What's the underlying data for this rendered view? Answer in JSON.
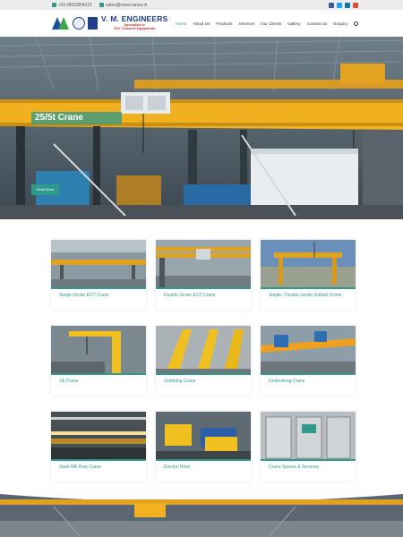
{
  "topbar": {
    "phone": "+91-8551894221",
    "email": "sales@vmecranes.in",
    "socials": [
      "facebook-icon",
      "twitter-icon",
      "linkedin-icon",
      "google-plus-icon"
    ]
  },
  "header": {
    "brand_name": "V. M. ENGINEERS",
    "brand_tagline_1": "Specialists in",
    "brand_tagline_2": "EOT Cranes & Equipments",
    "logo_text": "V M ENGINEERS",
    "nav": [
      "Home",
      "About Us",
      "Products",
      "Services",
      "Our Clients",
      "Gallery",
      "Contact Us",
      "Enquiry"
    ]
  },
  "hero": {
    "title": "25/5t Crane",
    "button_label": "Read More"
  },
  "products": [
    {
      "label": "Single Girder EOT Crane"
    },
    {
      "label": "Double Girder EOT Crane"
    },
    {
      "label": "Single / Double Girder Goliath Crane"
    },
    {
      "label": "Jib Crane"
    },
    {
      "label": "Grabbing Crane"
    },
    {
      "label": "Underslung Crane"
    },
    {
      "label": "Steel Mill Duty Crane"
    },
    {
      "label": "Electric Hoist"
    },
    {
      "label": "Crane Spares & Services"
    }
  ],
  "colors": {
    "accent": "#2e9a8e",
    "brand_blue": "#1e3d8a",
    "crane_yellow": "#f0b020"
  }
}
